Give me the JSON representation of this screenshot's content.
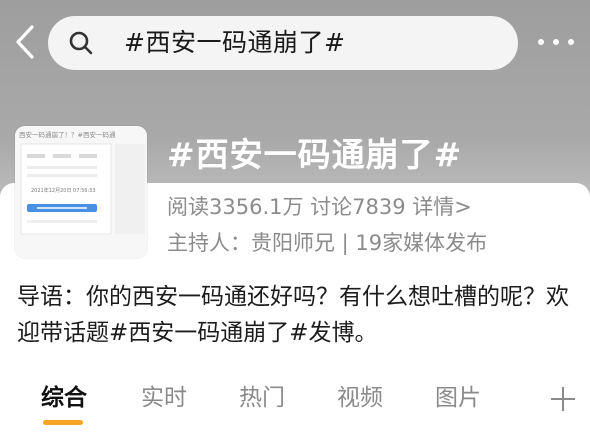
{
  "header": {
    "search_text": "#西安一码通崩了#"
  },
  "topic": {
    "title": "#西安一码通崩了#",
    "cover_caption": "西安一码通崩了！？  #西安一码通",
    "cover_date": "2021年12月20日 07:56:33",
    "stats": "阅读3356.1万  讨论7839  详情>",
    "host": "主持人：贵阳师兄 | 19家媒体发布",
    "intro": "导语：你的西安一码通还好吗？有什么想吐槽的呢？欢迎带话题#西安一码通崩了#发博。"
  },
  "tabs": [
    "综合",
    "实时",
    "热门",
    "视频",
    "图片"
  ],
  "colors": {
    "accent": "#f5a623",
    "muted_text": "#8b8b8b"
  }
}
